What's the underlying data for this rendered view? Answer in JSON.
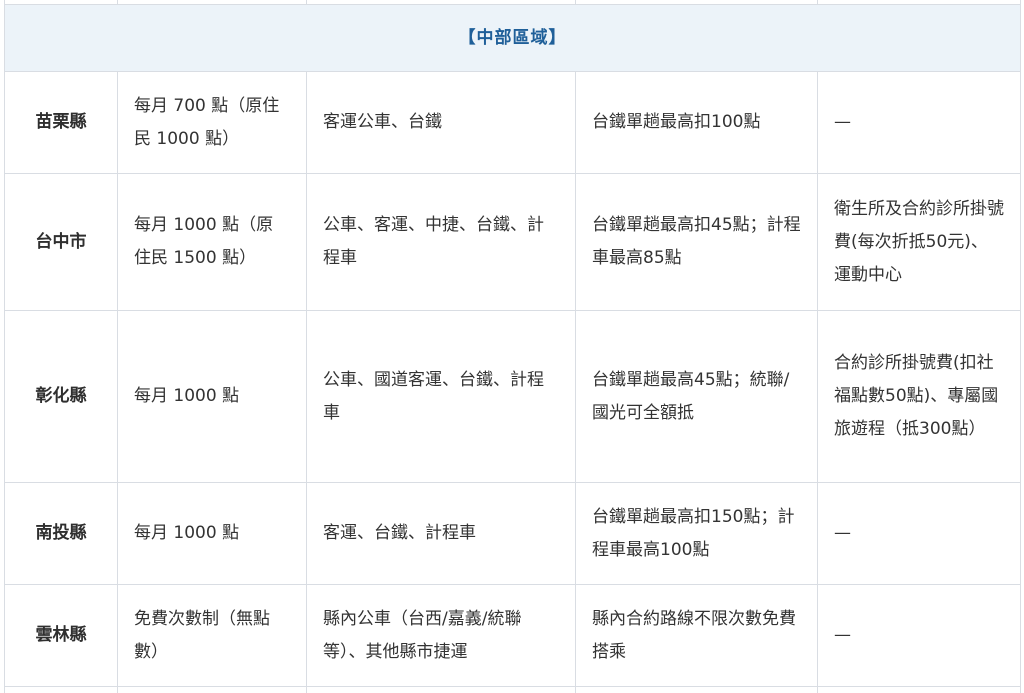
{
  "section_title": "【中部區域】",
  "rows": [
    {
      "county": "苗栗縣",
      "points": "每月 700 點（原住民 1000 點）",
      "transport": "客運公車、台鐵",
      "limit": "台鐵單趟最高扣100點",
      "other": "—"
    },
    {
      "county": "台中市",
      "points": "每月 1000 點（原住民 1500 點）",
      "transport": "公車、客運、中捷、台鐵、計程車",
      "limit": "台鐵單趟最高扣45點；計程車最高85點",
      "other": "衛生所及合約診所掛號費(每次折抵50元)、運動中心"
    },
    {
      "county": "彰化縣",
      "points": "每月 1000 點",
      "transport": "公車、國道客運、台鐵、計程車",
      "limit": "台鐵單趟最高45點；統聯/國光可全額抵",
      "other": "合約診所掛號費(扣社福點數50點)、專屬國旅遊程（抵300點）"
    },
    {
      "county": "南投縣",
      "points": "每月 1000 點",
      "transport": "客運、台鐵、計程車",
      "limit": "台鐵單趟最高扣150點；計程車最高100點",
      "other": "—"
    },
    {
      "county": "雲林縣",
      "points": "免費次數制（無點數）",
      "transport": "縣內公車（台西/嘉義/統聯等）、其他縣市捷運",
      "limit": "縣內合約路線不限次數免費搭乘",
      "other": "—"
    }
  ]
}
